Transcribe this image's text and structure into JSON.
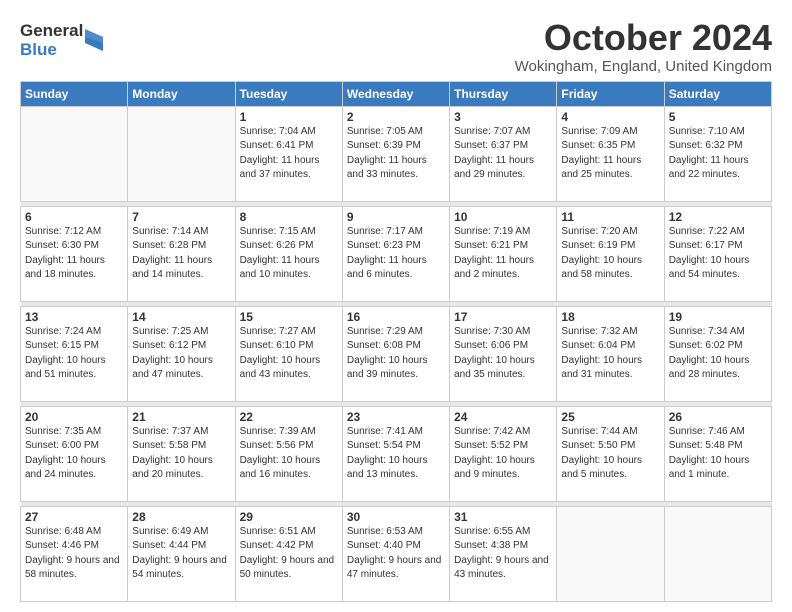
{
  "header": {
    "logo_general": "General",
    "logo_blue": "Blue",
    "month_title": "October 2024",
    "location": "Wokingham, England, United Kingdom"
  },
  "days_of_week": [
    "Sunday",
    "Monday",
    "Tuesday",
    "Wednesday",
    "Thursday",
    "Friday",
    "Saturday"
  ],
  "weeks": [
    [
      {
        "day": "",
        "sunrise": "",
        "sunset": "",
        "daylight": ""
      },
      {
        "day": "",
        "sunrise": "",
        "sunset": "",
        "daylight": ""
      },
      {
        "day": "1",
        "sunrise": "Sunrise: 7:04 AM",
        "sunset": "Sunset: 6:41 PM",
        "daylight": "Daylight: 11 hours and 37 minutes."
      },
      {
        "day": "2",
        "sunrise": "Sunrise: 7:05 AM",
        "sunset": "Sunset: 6:39 PM",
        "daylight": "Daylight: 11 hours and 33 minutes."
      },
      {
        "day": "3",
        "sunrise": "Sunrise: 7:07 AM",
        "sunset": "Sunset: 6:37 PM",
        "daylight": "Daylight: 11 hours and 29 minutes."
      },
      {
        "day": "4",
        "sunrise": "Sunrise: 7:09 AM",
        "sunset": "Sunset: 6:35 PM",
        "daylight": "Daylight: 11 hours and 25 minutes."
      },
      {
        "day": "5",
        "sunrise": "Sunrise: 7:10 AM",
        "sunset": "Sunset: 6:32 PM",
        "daylight": "Daylight: 11 hours and 22 minutes."
      }
    ],
    [
      {
        "day": "6",
        "sunrise": "Sunrise: 7:12 AM",
        "sunset": "Sunset: 6:30 PM",
        "daylight": "Daylight: 11 hours and 18 minutes."
      },
      {
        "day": "7",
        "sunrise": "Sunrise: 7:14 AM",
        "sunset": "Sunset: 6:28 PM",
        "daylight": "Daylight: 11 hours and 14 minutes."
      },
      {
        "day": "8",
        "sunrise": "Sunrise: 7:15 AM",
        "sunset": "Sunset: 6:26 PM",
        "daylight": "Daylight: 11 hours and 10 minutes."
      },
      {
        "day": "9",
        "sunrise": "Sunrise: 7:17 AM",
        "sunset": "Sunset: 6:23 PM",
        "daylight": "Daylight: 11 hours and 6 minutes."
      },
      {
        "day": "10",
        "sunrise": "Sunrise: 7:19 AM",
        "sunset": "Sunset: 6:21 PM",
        "daylight": "Daylight: 11 hours and 2 minutes."
      },
      {
        "day": "11",
        "sunrise": "Sunrise: 7:20 AM",
        "sunset": "Sunset: 6:19 PM",
        "daylight": "Daylight: 10 hours and 58 minutes."
      },
      {
        "day": "12",
        "sunrise": "Sunrise: 7:22 AM",
        "sunset": "Sunset: 6:17 PM",
        "daylight": "Daylight: 10 hours and 54 minutes."
      }
    ],
    [
      {
        "day": "13",
        "sunrise": "Sunrise: 7:24 AM",
        "sunset": "Sunset: 6:15 PM",
        "daylight": "Daylight: 10 hours and 51 minutes."
      },
      {
        "day": "14",
        "sunrise": "Sunrise: 7:25 AM",
        "sunset": "Sunset: 6:12 PM",
        "daylight": "Daylight: 10 hours and 47 minutes."
      },
      {
        "day": "15",
        "sunrise": "Sunrise: 7:27 AM",
        "sunset": "Sunset: 6:10 PM",
        "daylight": "Daylight: 10 hours and 43 minutes."
      },
      {
        "day": "16",
        "sunrise": "Sunrise: 7:29 AM",
        "sunset": "Sunset: 6:08 PM",
        "daylight": "Daylight: 10 hours and 39 minutes."
      },
      {
        "day": "17",
        "sunrise": "Sunrise: 7:30 AM",
        "sunset": "Sunset: 6:06 PM",
        "daylight": "Daylight: 10 hours and 35 minutes."
      },
      {
        "day": "18",
        "sunrise": "Sunrise: 7:32 AM",
        "sunset": "Sunset: 6:04 PM",
        "daylight": "Daylight: 10 hours and 31 minutes."
      },
      {
        "day": "19",
        "sunrise": "Sunrise: 7:34 AM",
        "sunset": "Sunset: 6:02 PM",
        "daylight": "Daylight: 10 hours and 28 minutes."
      }
    ],
    [
      {
        "day": "20",
        "sunrise": "Sunrise: 7:35 AM",
        "sunset": "Sunset: 6:00 PM",
        "daylight": "Daylight: 10 hours and 24 minutes."
      },
      {
        "day": "21",
        "sunrise": "Sunrise: 7:37 AM",
        "sunset": "Sunset: 5:58 PM",
        "daylight": "Daylight: 10 hours and 20 minutes."
      },
      {
        "day": "22",
        "sunrise": "Sunrise: 7:39 AM",
        "sunset": "Sunset: 5:56 PM",
        "daylight": "Daylight: 10 hours and 16 minutes."
      },
      {
        "day": "23",
        "sunrise": "Sunrise: 7:41 AM",
        "sunset": "Sunset: 5:54 PM",
        "daylight": "Daylight: 10 hours and 13 minutes."
      },
      {
        "day": "24",
        "sunrise": "Sunrise: 7:42 AM",
        "sunset": "Sunset: 5:52 PM",
        "daylight": "Daylight: 10 hours and 9 minutes."
      },
      {
        "day": "25",
        "sunrise": "Sunrise: 7:44 AM",
        "sunset": "Sunset: 5:50 PM",
        "daylight": "Daylight: 10 hours and 5 minutes."
      },
      {
        "day": "26",
        "sunrise": "Sunrise: 7:46 AM",
        "sunset": "Sunset: 5:48 PM",
        "daylight": "Daylight: 10 hours and 1 minute."
      }
    ],
    [
      {
        "day": "27",
        "sunrise": "Sunrise: 6:48 AM",
        "sunset": "Sunset: 4:46 PM",
        "daylight": "Daylight: 9 hours and 58 minutes."
      },
      {
        "day": "28",
        "sunrise": "Sunrise: 6:49 AM",
        "sunset": "Sunset: 4:44 PM",
        "daylight": "Daylight: 9 hours and 54 minutes."
      },
      {
        "day": "29",
        "sunrise": "Sunrise: 6:51 AM",
        "sunset": "Sunset: 4:42 PM",
        "daylight": "Daylight: 9 hours and 50 minutes."
      },
      {
        "day": "30",
        "sunrise": "Sunrise: 6:53 AM",
        "sunset": "Sunset: 4:40 PM",
        "daylight": "Daylight: 9 hours and 47 minutes."
      },
      {
        "day": "31",
        "sunrise": "Sunrise: 6:55 AM",
        "sunset": "Sunset: 4:38 PM",
        "daylight": "Daylight: 9 hours and 43 minutes."
      },
      {
        "day": "",
        "sunrise": "",
        "sunset": "",
        "daylight": ""
      },
      {
        "day": "",
        "sunrise": "",
        "sunset": "",
        "daylight": ""
      }
    ]
  ]
}
